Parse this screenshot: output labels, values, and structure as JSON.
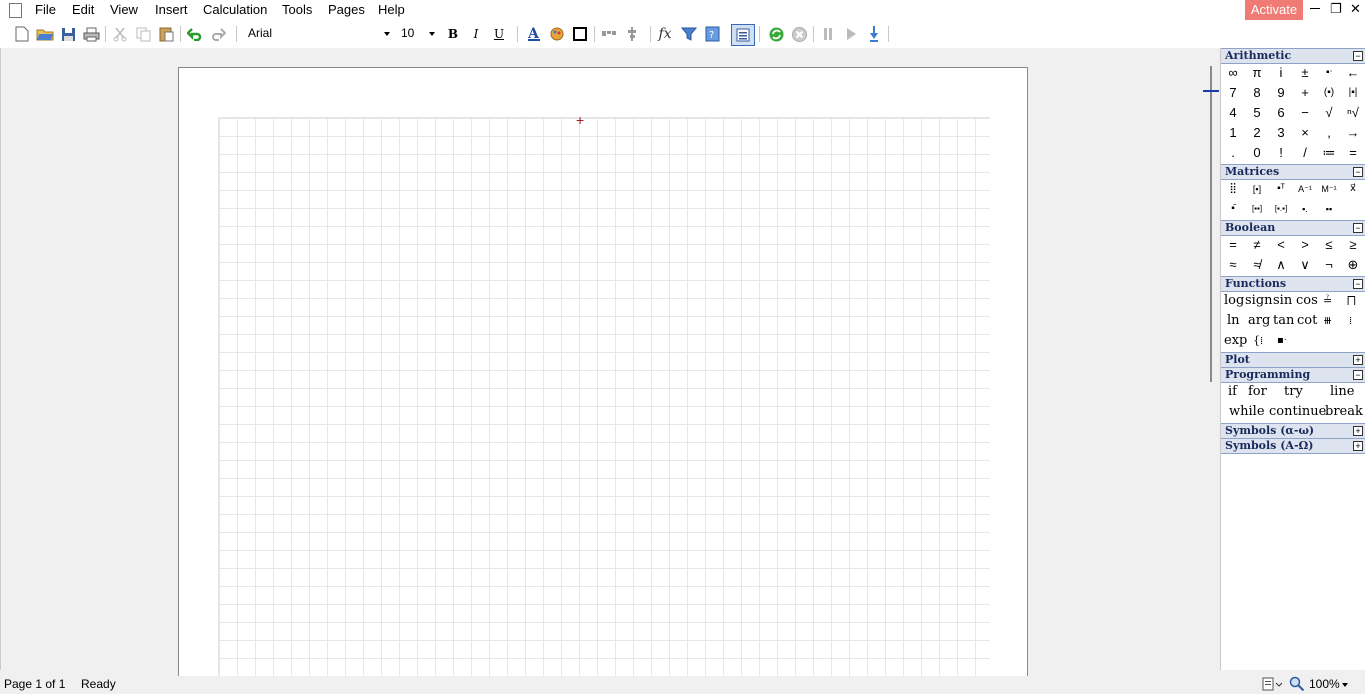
{
  "menu": [
    "File",
    "Edit",
    "View",
    "Insert",
    "Calculation",
    "Tools",
    "Pages",
    "Help"
  ],
  "activate_label": "Activate",
  "window_controls": {
    "minimize": "—",
    "restore": "❐",
    "close": "✕"
  },
  "toolbar": {
    "font_name": "Arial",
    "font_size": "10",
    "bold": "B",
    "italic": "I",
    "underline": "U",
    "fx": "fx"
  },
  "panel": {
    "arithmetic": {
      "title": "Arithmetic",
      "rows": [
        [
          "∞",
          "π",
          "i",
          "±",
          "▪ᐧ",
          "←"
        ],
        [
          "7",
          "8",
          "9",
          "+",
          "(▪)",
          "|▪|"
        ],
        [
          "4",
          "5",
          "6",
          "−",
          "√",
          "ⁿ√"
        ],
        [
          "1",
          "2",
          "3",
          "×",
          ",",
          "→"
        ],
        [
          ".",
          "0",
          "!",
          "/",
          "≔",
          "="
        ]
      ]
    },
    "matrices": {
      "title": "Matrices",
      "rows": [
        [
          "⣿",
          "[▪]",
          "▪ᵀ",
          "A⁻¹",
          "M⁻¹",
          "x⃗"
        ],
        [
          "▪̄",
          "[▪▪]",
          "[▪.▪]",
          "▪.",
          "▪▪"
        ]
      ]
    },
    "boolean": {
      "title": "Boolean",
      "rows": [
        [
          "=",
          "≠",
          "<",
          ">",
          "≤",
          "≥"
        ],
        [
          "≈",
          "≉",
          "∧",
          "∨",
          "¬",
          "⊕"
        ]
      ]
    },
    "functions": {
      "title": "Functions",
      "rows": [
        [
          "log",
          "sign",
          "sin",
          "cos",
          "≟",
          "⨅"
        ],
        [
          "ln",
          "arg",
          "tan",
          "cot",
          "⧻",
          "⁞"
        ],
        [
          "exp",
          "{⁞",
          "▪ᐧ"
        ]
      ]
    },
    "plot": {
      "title": "Plot"
    },
    "programming": {
      "title": "Programming",
      "row1": [
        "if",
        "for",
        "try",
        "line"
      ],
      "row2": [
        "while",
        "continue",
        "break"
      ]
    },
    "symbols_lower": {
      "title": "Symbols (α-ω)"
    },
    "symbols_upper": {
      "title": "Symbols (Α-Ω)"
    }
  },
  "status": {
    "page": "Page 1 of 1",
    "state": "Ready",
    "zoom": "100%"
  },
  "colors": {
    "activate": "#f07a74",
    "panel_header": "#dde4f0",
    "grid": "#e6e6e6"
  }
}
